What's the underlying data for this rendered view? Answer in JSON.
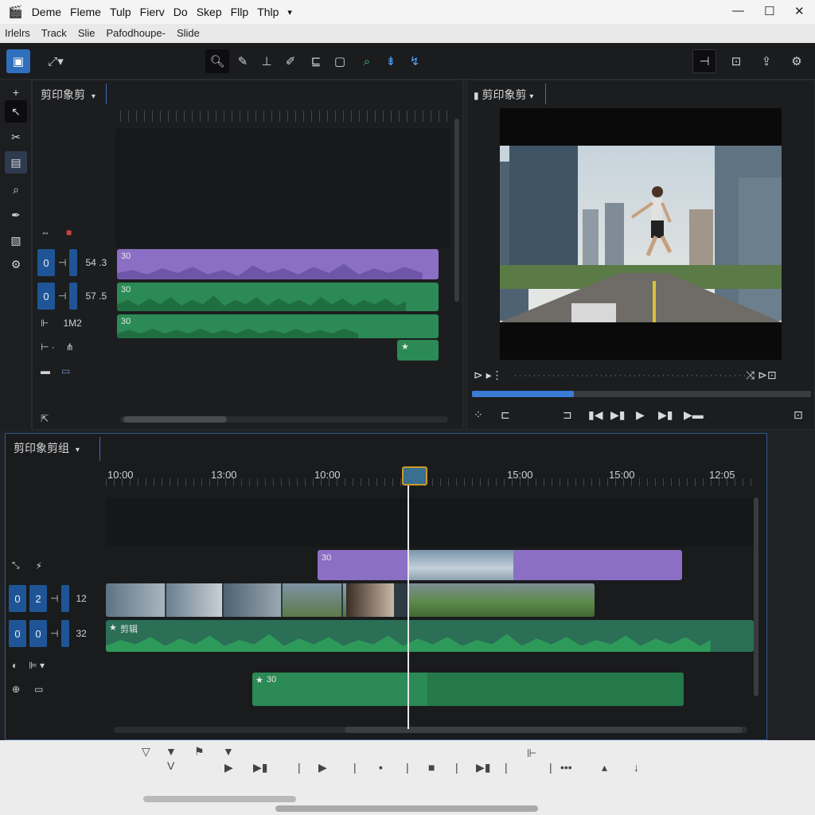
{
  "titlebar": {
    "app_icon": "clapperboard-icon",
    "menu": [
      "Deme",
      "Fleme",
      "Tulp",
      "Fierv",
      "Do",
      "Skep",
      "Fllp",
      "Thlp"
    ],
    "menu_more": "▾",
    "window_controls": {
      "minimize": "—",
      "maximize": "☐",
      "close": "✕"
    }
  },
  "subbar": {
    "items": [
      "Irlelrs",
      "Track",
      "Slie",
      "Pafodhoupe-",
      "Slide"
    ]
  },
  "source_panel": {
    "tab_label": "剪印象剪",
    "tracks": [
      {
        "num": "0",
        "label": "54 .3"
      },
      {
        "num": "0",
        "label": "57 .5"
      },
      {
        "label": "1M2"
      }
    ],
    "clips": [
      {
        "label": "30",
        "color": "purple"
      },
      {
        "label": "30",
        "color": "green"
      },
      {
        "label": "30",
        "color": "green"
      }
    ]
  },
  "viewer": {
    "tab_label": "剪印象剪",
    "progress": 0.3
  },
  "timeline": {
    "tab_label": "剪印象剪组",
    "times": [
      "10:00",
      "13:00",
      "10:00",
      "15:00",
      "15:00",
      "12:05"
    ],
    "tracks": [
      {
        "nums": [
          "0",
          "2"
        ],
        "label": "12"
      },
      {
        "nums": [
          "0",
          "0"
        ],
        "label": "32"
      }
    ],
    "clips": [
      {
        "label": "30",
        "color": "purple"
      },
      {
        "label": "剪辑",
        "color": "green"
      },
      {
        "label": "30",
        "color": "green"
      }
    ]
  },
  "colors": {
    "accent_blue": "#2f6fbd",
    "clip_purple": "#8a6fc4",
    "clip_green": "#2b8a55",
    "playhead_marker": "#c89a2b"
  }
}
